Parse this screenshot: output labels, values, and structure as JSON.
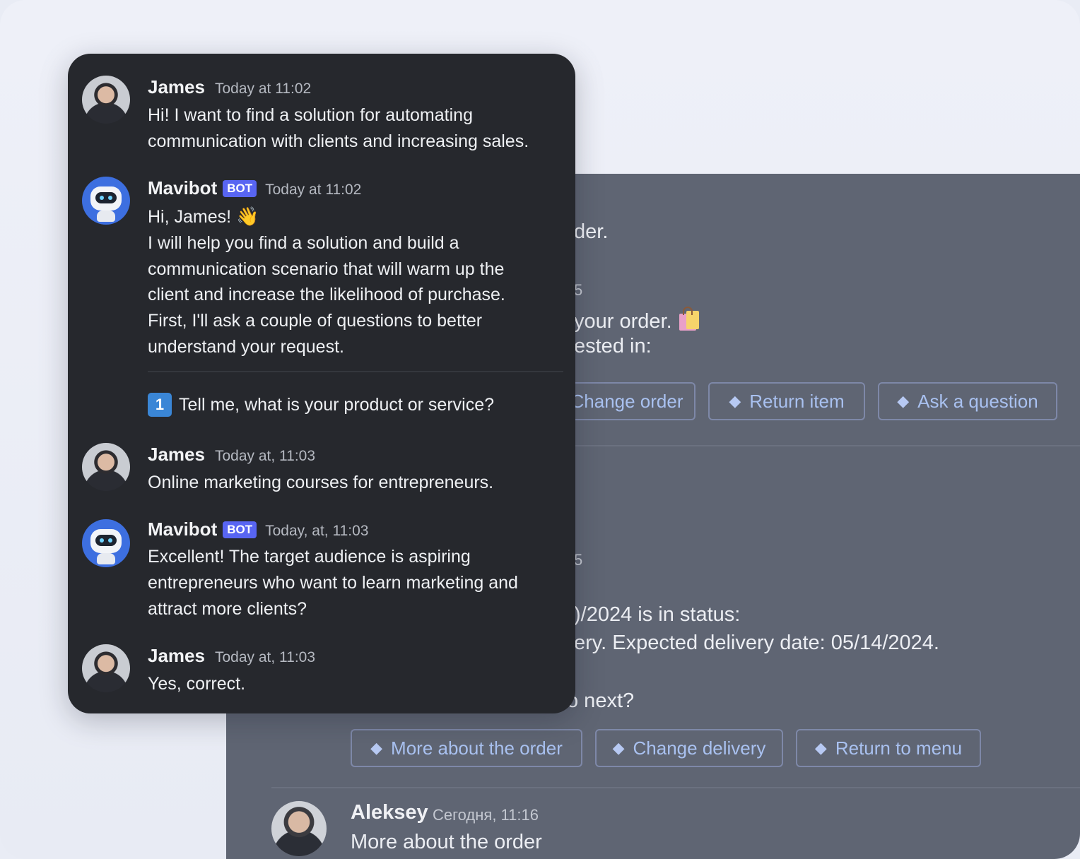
{
  "background_chat": {
    "fragments": {
      "order_line": "der.",
      "date_fragment_1": "5",
      "your_order": "your order.",
      "interested_in": "ested in:",
      "date_fragment_2": "5",
      "status_line": ")/2024 is in status:",
      "delivery_line": "ery. Expected delivery date: 05/14/2024.",
      "next_line": "o next?"
    },
    "buttons_row1": [
      {
        "label": "Change order",
        "icon": "gem-icon"
      },
      {
        "label": "Return item",
        "icon": "gem-icon"
      },
      {
        "label": "Ask a question",
        "icon": "gem-icon"
      }
    ],
    "buttons_row2": [
      {
        "label": "More about the order",
        "icon": "gem-icon"
      },
      {
        "label": "Change delivery",
        "icon": "gem-icon"
      },
      {
        "label": "Return to menu",
        "icon": "gem-icon"
      }
    ],
    "last_message": {
      "author": "Aleksey",
      "time": "Сегодня, 11:16",
      "text": "More about the order"
    }
  },
  "chat": {
    "messages": [
      {
        "author": "James",
        "time": "Today at 11:02",
        "lines": [
          "Hi! I want to find a solution for automating",
          "communication with clients and increasing sales."
        ]
      },
      {
        "author": "Mavibot",
        "badge": "BOT",
        "time": "Today at 11:02",
        "lines": [
          "Hi, James!",
          "I will help you find a solution and build a",
          "communication scenario that will warm up the",
          "client and increase the likelihood of purchase.",
          "First, I'll ask a couple of questions to better",
          "understand your request."
        ],
        "emoji": "👋",
        "question_number": "1",
        "question": "Tell me, what is your product or service?"
      },
      {
        "author": "James",
        "time": "Today at, 11:03",
        "lines": [
          "Online marketing courses for entrepreneurs."
        ]
      },
      {
        "author": "Mavibot",
        "badge": "BOT",
        "time": "Today, at, 11:03",
        "lines": [
          "Excellent! The target audience is aspiring",
          "entrepreneurs who want to learn marketing and",
          "attract more clients?"
        ]
      },
      {
        "author": "James",
        "time": "Today at, 11:03",
        "lines": [
          "Yes, correct."
        ]
      }
    ]
  },
  "colors": {
    "card_bg": "#26282d",
    "bg_panel": "#5f6573",
    "bot_badge": "#5865f2",
    "button_text": "#a9c1f0"
  }
}
